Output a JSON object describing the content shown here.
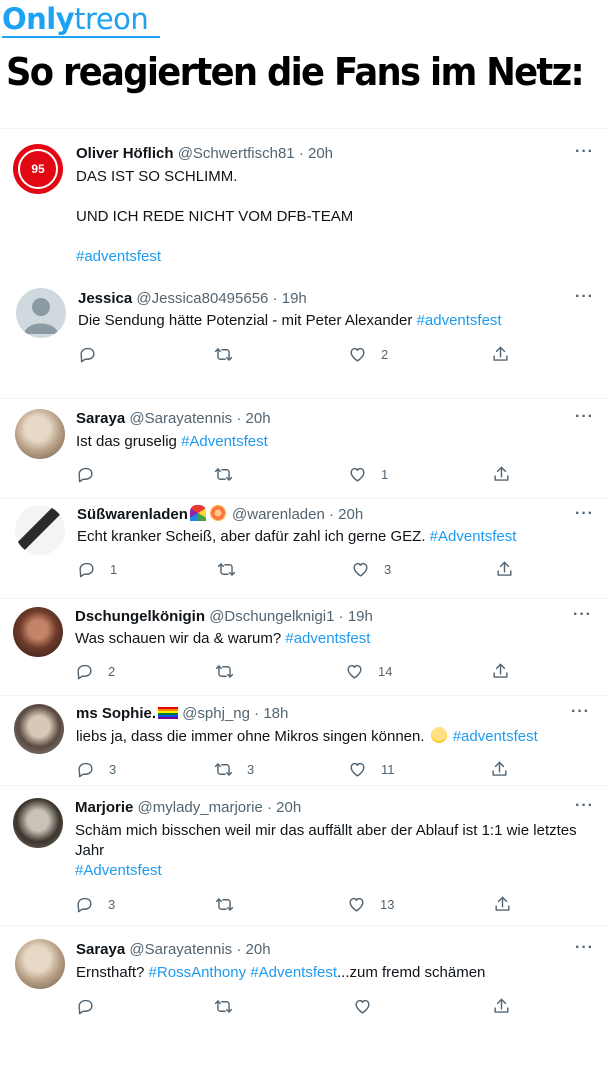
{
  "watermark": {
    "brand_first": "Only",
    "brand_second": "treon"
  },
  "headline": "So reagierten die Fans im Netz:",
  "more_label": "···",
  "tweets": [
    {
      "name": "Oliver Höflich",
      "handle": "@Schwertfisch81",
      "time": "20h",
      "avatar": "fortuna-95-crest",
      "avatar_text": "95",
      "lines": [
        "DAS IST SO SCHLIMM.",
        "",
        "UND ICH REDE NICHT VOM DFB-TEAM",
        "",
        ""
      ],
      "hashtag_line": "#adventsfest",
      "show_actions": false
    },
    {
      "name": "Jessica",
      "handle": "@Jessica80495656",
      "time": "19h",
      "avatar": "default-profile",
      "text": "Die Sendung hätte Potenzial - mit Peter Alexander ",
      "hashtag": "#adventsfest",
      "replies": "",
      "retweets": "",
      "likes": "2"
    },
    {
      "name": "Saraya",
      "handle": "@Sarayatennis",
      "time": "20h",
      "avatar": "blonde-woman-photo",
      "text": "Ist das gruselig ",
      "hashtag": "#Adventsfest",
      "replies": "",
      "retweets": "",
      "likes": "1"
    },
    {
      "name": "Süßwarenladen",
      "name_emoji": "rainbow-lollipop",
      "handle": "@warenladen",
      "time": "20h",
      "avatar": "sketch-face",
      "text": "Echt kranker Scheiß, aber dafür zahl ich gerne GEZ. ",
      "hashtag": "#Adventsfest",
      "replies": "1",
      "retweets": "",
      "likes": "3"
    },
    {
      "name": "Dschungelkönigin",
      "handle": "@Dschungelknigi1",
      "time": "19h",
      "avatar": "crowned-woman-photo",
      "text": "Was schauen wir da & warum? ",
      "hashtag": "#adventsfest",
      "replies": "2",
      "retweets": "",
      "likes": "14"
    },
    {
      "name": "ms Sophie.",
      "name_emoji": "rainbow-flag",
      "handle": "@sphj_ng",
      "time": "18h",
      "avatar": "sophie-photo",
      "text": "liebs ja, dass die immer ohne Mikros singen können. ",
      "emoji": "relieved-face",
      "hashtag": "#adventsfest",
      "replies": "3",
      "retweets": "3",
      "likes": "11"
    },
    {
      "name": "Marjorie",
      "handle": "@mylady_marjorie",
      "time": "20h",
      "avatar": "vintage-portrait",
      "lines": [
        "Schäm mich bisschen weil mir das auffällt aber der Ablauf ist 1:1 wie letztes",
        "Jahr"
      ],
      "hashtag_line": "#Adventsfest",
      "replies": "3",
      "retweets": "",
      "likes": "13"
    },
    {
      "name": "Saraya",
      "handle": "@Sarayatennis",
      "time": "20h",
      "avatar": "blonde-woman-photo",
      "text_before": "Ernsthaft? ",
      "hashtag_a": "#RossAnthony",
      "hashtag_b": "#Adventsfest",
      "text_after": "...zum fremd schämen",
      "replies": "",
      "retweets": "",
      "likes": ""
    }
  ],
  "colors": {
    "accent": "#1d9bf0",
    "text": "#0f1419",
    "muted": "#536471",
    "divider": "#eff3f4",
    "brand": "#1da1f2"
  },
  "icons": [
    "reply-icon",
    "retweet-icon",
    "like-icon",
    "share-icon",
    "more-icon"
  ]
}
